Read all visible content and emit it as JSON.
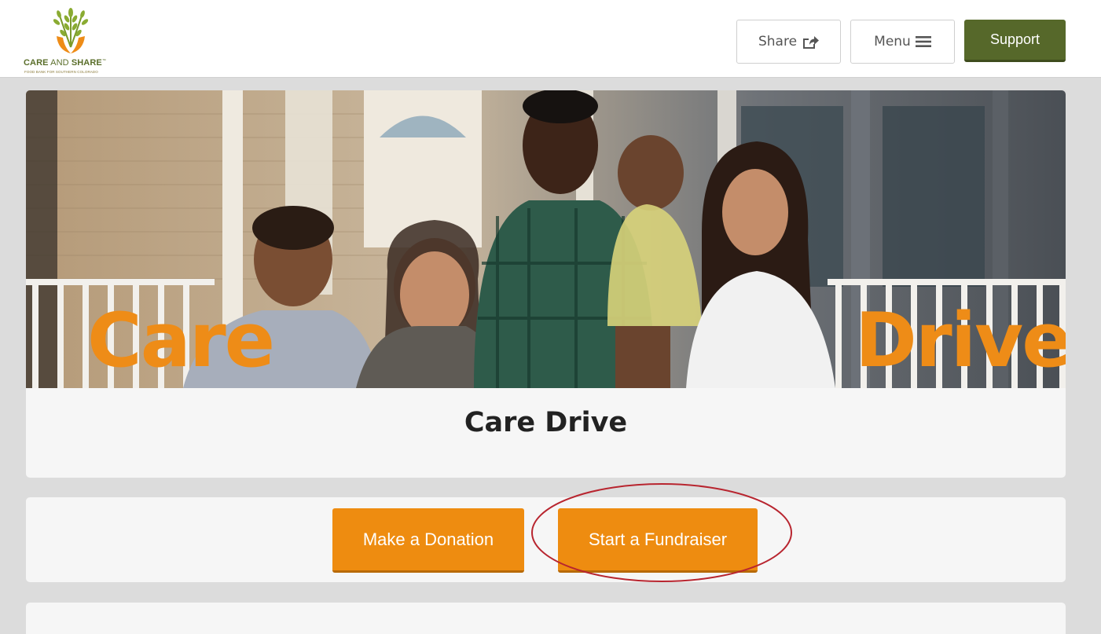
{
  "brand": {
    "name_care": "CARE",
    "name_and": " AND ",
    "name_share": "SHARE",
    "trademark": "™",
    "tagline": "FOOD BANK FOR SOUTHERN COLORADO"
  },
  "header": {
    "share_label": "Share",
    "menu_label": "Menu",
    "support_label": "Support"
  },
  "hero": {
    "word_left": "Care",
    "word_right": "Drive"
  },
  "page": {
    "title": "Care Drive"
  },
  "actions": {
    "donate_label": "Make a Donation",
    "fundraiser_label": "Start a Fundraiser"
  },
  "colors": {
    "accent_orange": "#ee8c10",
    "brand_green": "#56682a",
    "highlight_red": "#b8252f"
  }
}
